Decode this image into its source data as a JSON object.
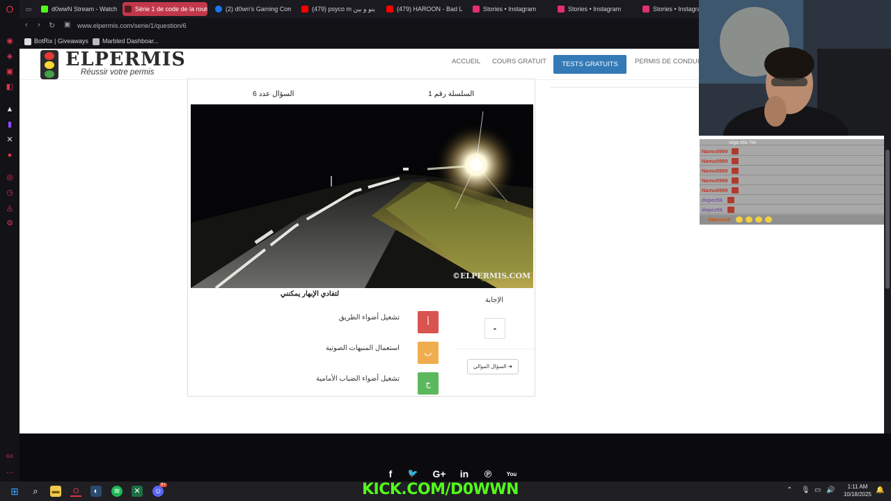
{
  "browser": {
    "tabs": [
      {
        "label": "d0wwN Stream - Watch",
        "color": "#53fc18"
      },
      {
        "label": "Série 1 de code de la route",
        "color": "#c0384a",
        "active": true
      },
      {
        "label": "(2) d0wn's Gaming Com",
        "color": "#1877f2"
      },
      {
        "label": "(479) psyco m ينو و بين",
        "color": "#ff0000"
      },
      {
        "label": "(479) HAROON - Bad L",
        "color": "#ff0000"
      },
      {
        "label": "Stories • Instagram",
        "color": "#e1306c"
      },
      {
        "label": "Stories • Instagram",
        "color": "#e1306c"
      },
      {
        "label": "Stories • Instagra",
        "color": "#e1306c"
      }
    ],
    "url": "www.elpermis.com/serie/1/question/6",
    "bookmarks": [
      "BotRix | Giveaways",
      "Marbled Dashboar..."
    ]
  },
  "site": {
    "logo": "ELPERMIS",
    "slogan": "Réussir votre permis",
    "menu": {
      "home": "ACCUEIL",
      "courses": "COURS GRATUIT",
      "tests": "TESTS GRATUITS",
      "licence": "PERMIS DE CONDUIRE"
    }
  },
  "quiz": {
    "series": "السلسلة رقم 1",
    "question_number": "السؤال عدد 6",
    "question": "لتفادي الإبهار يمكنني",
    "watermark": "©ELPERMIS.COM",
    "options": [
      {
        "letter": "أ",
        "text": "تشغيل أضواء الطريق",
        "color": "#d9534f"
      },
      {
        "letter": "ب",
        "text": "استعمال المنبهات الصوتية",
        "color": "#f0ad4e"
      },
      {
        "letter": "ج",
        "text": "تشغيل أضواء الضباب الأمامية",
        "color": "#5cb85c"
      }
    ],
    "answer_label": "الإجابة",
    "answer_value": "-",
    "next_button": "السؤال الموالي"
  },
  "footer": {
    "social": [
      "f",
      "t",
      "G+",
      "in",
      "p",
      "You"
    ],
    "stream_banner": "KICK.COM/D0WWN"
  },
  "chat": {
    "top_text": "ulga trla ?et",
    "rows": [
      {
        "user": "Namu0999"
      },
      {
        "user": "Namu0999"
      },
      {
        "user": "Namu0999"
      },
      {
        "user": "Namu0999"
      },
      {
        "user": "Namu0999"
      },
      {
        "user": "dopez56"
      },
      {
        "user": "dopez56"
      },
      {
        "user": "Vakiove0"
      }
    ]
  },
  "taskbar": {
    "time": "1:11 AM",
    "date": "10/18/2025",
    "discord_badge": "9+"
  }
}
